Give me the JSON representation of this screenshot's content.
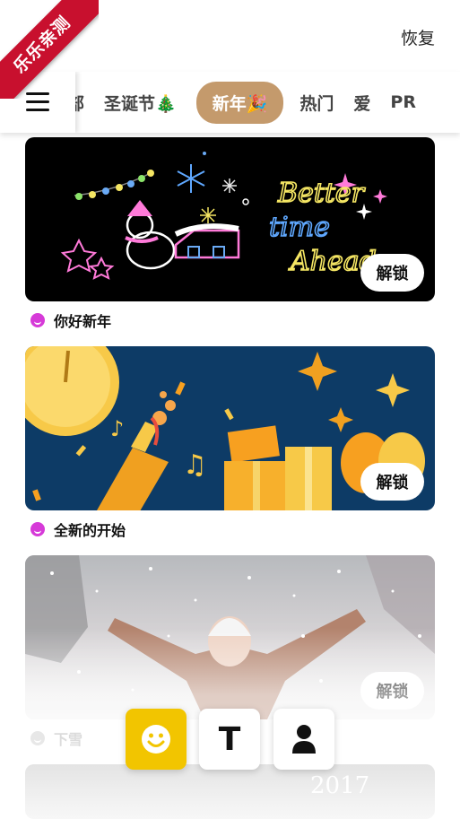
{
  "watermark": {
    "text": "乐乐亲测"
  },
  "header": {
    "restore_label": "恢复"
  },
  "tabs": [
    {
      "label": "全部"
    },
    {
      "label": "圣诞节🎄"
    },
    {
      "label": "新年🎉",
      "active": true
    },
    {
      "label": "热门"
    },
    {
      "label": "爱"
    },
    {
      "label": "PR"
    }
  ],
  "cards": [
    {
      "title": "你好新年",
      "unlock_label": "解锁",
      "art_text": [
        "Better",
        "time",
        "Ahead"
      ]
    },
    {
      "title": "全新的开始",
      "unlock_label": "解锁"
    },
    {
      "title": "下雪",
      "unlock_label": "解锁"
    },
    {
      "art_text": [
        "2017"
      ]
    }
  ],
  "bottom_bar": {
    "buttons": [
      {
        "icon": "smiley-icon",
        "active": true
      },
      {
        "icon": "text-icon",
        "glyph": "T"
      },
      {
        "icon": "person-icon"
      }
    ]
  },
  "colors": {
    "ribbon": "#c8102e",
    "active_tab": "#c49a6c",
    "emoji_button": "#f2c500",
    "caption_icon": "#d63ad8"
  }
}
